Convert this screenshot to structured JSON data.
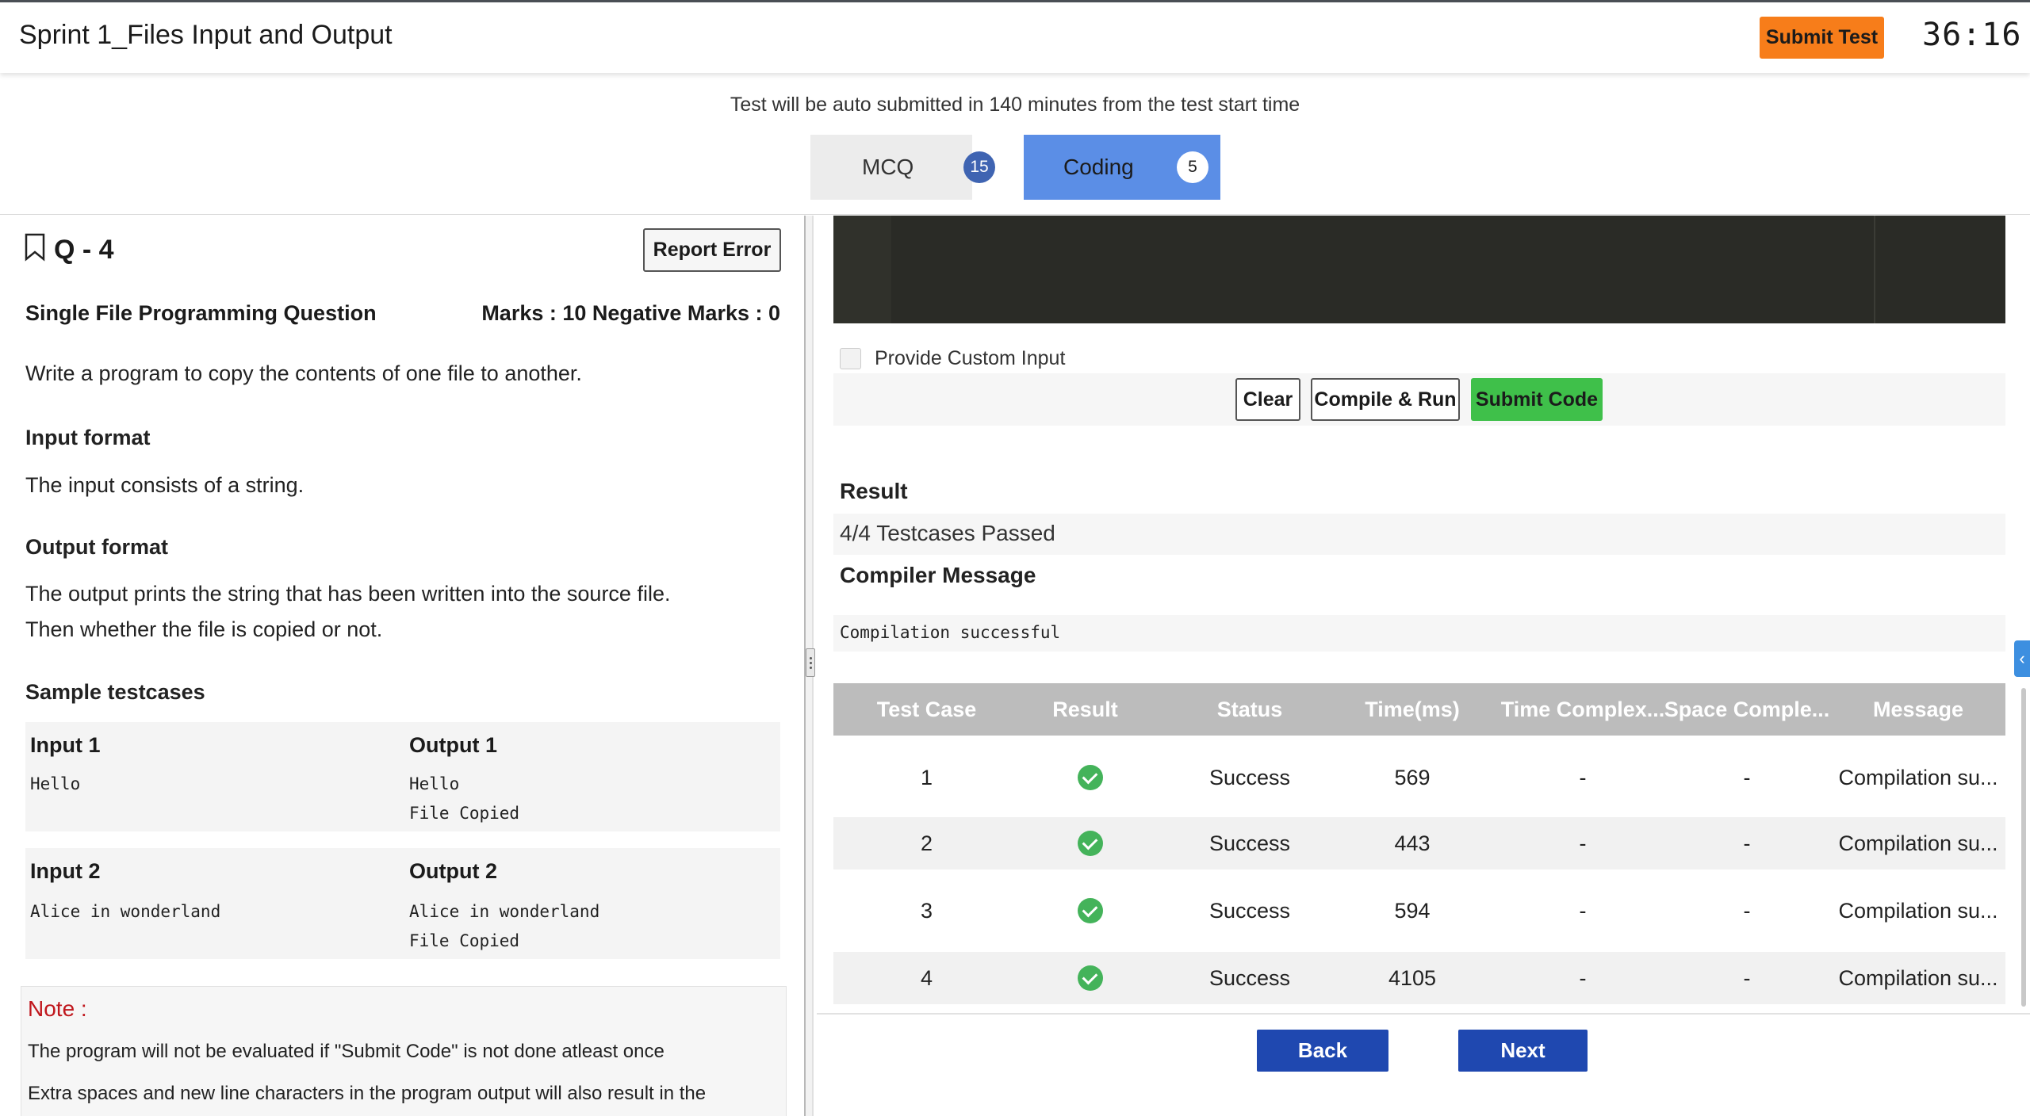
{
  "header": {
    "title": "Sprint 1_Files Input and Output",
    "submit_test": "Submit Test",
    "timer": "36:16"
  },
  "auto_submit_msg": "Test will be auto submitted in 140 minutes from the test start time",
  "tabs": [
    {
      "label": "MCQ",
      "count": "15",
      "active": false
    },
    {
      "label": "Coding",
      "count": "5",
      "active": true
    }
  ],
  "question": {
    "number": "Q - 4",
    "report_error": "Report Error",
    "type": "Single File Programming Question",
    "marks": "Marks : 10  Negative Marks : 0",
    "description": "Write a program to copy the contents of one file to another.",
    "input_format_head": "Input format",
    "input_format": "The input consists of a string.",
    "output_format_head": "Output format",
    "output_format_line1": "The output prints the string that has been written into the source file.",
    "output_format_line2": "Then whether the file is copied or not.",
    "sample_head": "Sample testcases",
    "samples": [
      {
        "input_label": "Input 1",
        "input": "Hello",
        "output_label": "Output 1",
        "output_line1": "Hello",
        "output_line2": "File Copied"
      },
      {
        "input_label": "Input 2",
        "input": "Alice in wonderland",
        "output_label": "Output 2",
        "output_line1": "Alice in wonderland",
        "output_line2": "File Copied"
      }
    ],
    "note_title": "Note :",
    "note_line1": "The program will not be evaluated if \"Submit Code\" is not done atleast once",
    "note_line2": "Extra spaces and new line characters in the program output will also result in the"
  },
  "editor_panel": {
    "custom_input_label": "Provide Custom Input",
    "clear": "Clear",
    "compile_run": "Compile & Run",
    "submit_code": "Submit Code",
    "result_head": "Result",
    "result_value": "4/4 Testcases Passed",
    "compiler_head": "Compiler Message",
    "compiler_value": "Compilation successful"
  },
  "results_table": {
    "headers": [
      "Test Case",
      "Result",
      "Status",
      "Time(ms)",
      "Time Complex...",
      "Space Comple...",
      "Message"
    ],
    "rows": [
      {
        "case": "1",
        "status": "Success",
        "time": "569",
        "time_complexity": "-",
        "space_complexity": "-",
        "message": "Compilation su..."
      },
      {
        "case": "2",
        "status": "Success",
        "time": "443",
        "time_complexity": "-",
        "space_complexity": "-",
        "message": "Compilation su..."
      },
      {
        "case": "3",
        "status": "Success",
        "time": "594",
        "time_complexity": "-",
        "space_complexity": "-",
        "message": "Compilation su..."
      },
      {
        "case": "4",
        "status": "Success",
        "time": "4105",
        "time_complexity": "-",
        "space_complexity": "-",
        "message": "Compilation su..."
      }
    ]
  },
  "nav": {
    "back": "Back",
    "next": "Next"
  },
  "colors": {
    "accent_orange": "#f77d1a",
    "tab_active": "#5b8ee6",
    "nav_blue": "#1f48b0",
    "success_green": "#3fc04a",
    "note_red": "#c0171d"
  }
}
